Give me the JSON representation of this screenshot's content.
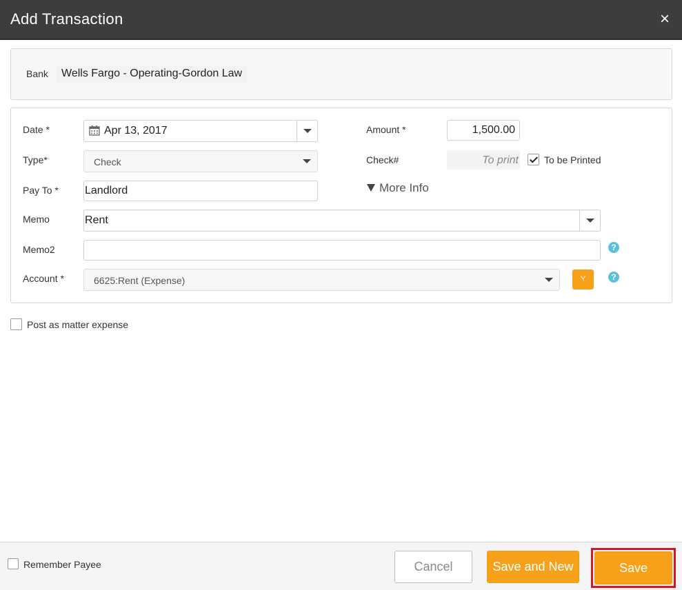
{
  "dialog": {
    "title": "Add Transaction",
    "close_icon": "close-icon"
  },
  "bank": {
    "label": "Bank",
    "value": "Wells Fargo - Operating-Gordon Law"
  },
  "form": {
    "date": {
      "label": "Date *",
      "value": "Apr 13, 2017"
    },
    "type": {
      "label": "Type*",
      "value": "Check"
    },
    "pay_to": {
      "label": "Pay To *",
      "value": "Landlord"
    },
    "memo": {
      "label": "Memo",
      "value": "Rent"
    },
    "memo2": {
      "label": "Memo2",
      "value": ""
    },
    "account": {
      "label": "Account *",
      "value": "6625:Rent (Expense)",
      "y_button": "Y"
    },
    "amount": {
      "label": "Amount *",
      "value": "1,500.00"
    },
    "check_number": {
      "label": "Check#",
      "placeholder": "To print"
    },
    "to_be_printed": {
      "label": "To be Printed",
      "checked": true
    },
    "more_info": "More Info",
    "help_glyph": "?"
  },
  "post_as_matter_expense": {
    "label": "Post as matter expense",
    "checked": false
  },
  "footer": {
    "remember_payee": {
      "label": "Remember Payee",
      "checked": false
    },
    "cancel_label": "Cancel",
    "save_and_new_label": "Save and New",
    "save_label": "Save"
  },
  "colors": {
    "accent": "#f7a11a",
    "titlebar": "#3d3d3d",
    "help": "#5bc0de",
    "highlight": "#e0121e"
  }
}
